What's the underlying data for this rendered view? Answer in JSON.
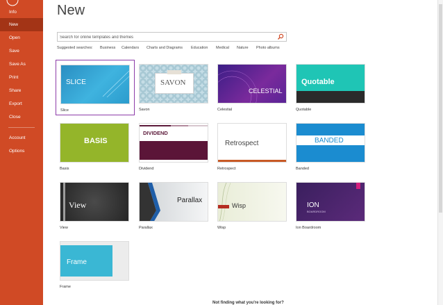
{
  "sidebar": {
    "items": [
      {
        "label": "Info"
      },
      {
        "label": "New"
      },
      {
        "label": "Open"
      },
      {
        "label": "Save"
      },
      {
        "label": "Save As"
      },
      {
        "label": "Print"
      },
      {
        "label": "Share"
      },
      {
        "label": "Export"
      },
      {
        "label": "Close"
      },
      {
        "label": "Account"
      },
      {
        "label": "Options"
      }
    ],
    "color": "#d04a25",
    "active_color": "#a33416"
  },
  "page": {
    "title": "New"
  },
  "search": {
    "placeholder": "Search for online templates and themes"
  },
  "suggested": {
    "label": "Suggested searches:",
    "items": [
      "Business",
      "Calendars",
      "Charts and Diagrams",
      "Education",
      "Medical",
      "Nature",
      "Photo albums"
    ]
  },
  "templates": [
    {
      "name": "Slice",
      "thumb_text": "SLICE",
      "selected": true
    },
    {
      "name": "Savon",
      "thumb_text": "SAVON"
    },
    {
      "name": "Celestial",
      "thumb_text": "CELESTIAL"
    },
    {
      "name": "Quotable",
      "thumb_text": "Quotable"
    },
    {
      "name": "Basis",
      "thumb_text": "BASIS"
    },
    {
      "name": "Dividend",
      "thumb_text": "DIVIDEND"
    },
    {
      "name": "Retrospect",
      "thumb_text": "Retrospect"
    },
    {
      "name": "Banded",
      "thumb_text": "BANDED"
    },
    {
      "name": "View",
      "thumb_text": "View"
    },
    {
      "name": "Parallax",
      "thumb_text": "Parallax"
    },
    {
      "name": "Wisp",
      "thumb_text": "Wisp"
    },
    {
      "name": "Ion Boardroom",
      "thumb_text": "ION",
      "thumb_subtext": "BOARDROOM"
    },
    {
      "name": "Frame",
      "thumb_text": "Frame"
    }
  ],
  "footer": {
    "link": "Not finding what you're looking for?"
  }
}
